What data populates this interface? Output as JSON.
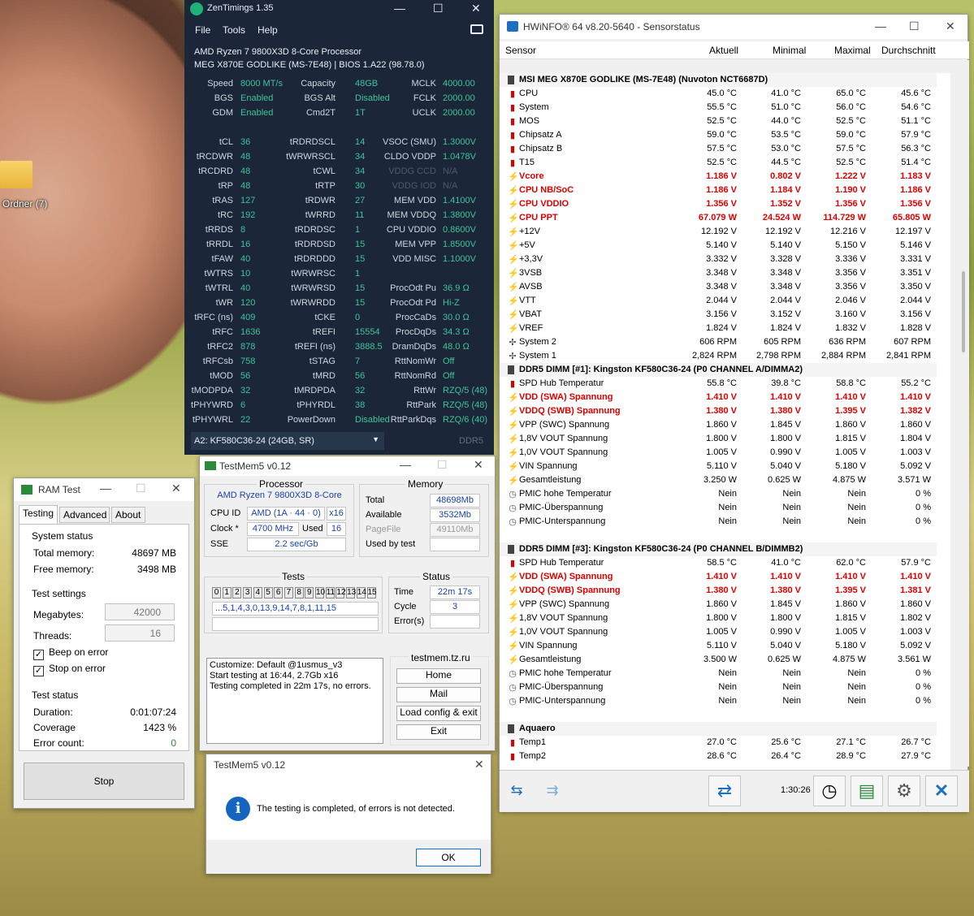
{
  "desktop": {
    "folder_label": "Ordner (7)"
  },
  "zentimings": {
    "title": "ZenTimings 1.35",
    "menu": [
      "File",
      "Tools",
      "Help"
    ],
    "cpu": "AMD Ryzen 7 9800X3D 8-Core Processor",
    "board": "MEG X870E GODLIKE (MS-7E48) | BIOS 1.A22 (98.78.0)",
    "rows": [
      [
        [
          "Speed",
          "8000 MT/s"
        ],
        [
          "Capacity",
          "48GB"
        ],
        [
          "MCLK",
          "4000.00"
        ]
      ],
      [
        [
          "BGS",
          "Enabled"
        ],
        [
          "BGS Alt",
          "Disabled"
        ],
        [
          "FCLK",
          "2000.00"
        ]
      ],
      [
        [
          "GDM",
          "Enabled"
        ],
        [
          "Cmd2T",
          "1T"
        ],
        [
          "UCLK",
          "2000.00"
        ]
      ],
      [
        [
          "",
          ""
        ],
        [
          "",
          ""
        ],
        [
          "",
          ""
        ]
      ],
      [
        [
          "tCL",
          "36"
        ],
        [
          "tRDRDSCL",
          "14"
        ],
        [
          "VSOC (SMU)",
          "1.3000V"
        ]
      ],
      [
        [
          "tRCDWR",
          "48"
        ],
        [
          "tWRWRSCL",
          "34"
        ],
        [
          "CLDO VDDP",
          "1.0478V"
        ]
      ],
      [
        [
          "tRCDRD",
          "48"
        ],
        [
          "tCWL",
          "34"
        ],
        [
          "VDDG CCD",
          "N/A"
        ]
      ],
      [
        [
          "tRP",
          "48"
        ],
        [
          "tRTP",
          "30"
        ],
        [
          "VDDG IOD",
          "N/A"
        ]
      ],
      [
        [
          "tRAS",
          "127"
        ],
        [
          "tRDWR",
          "27"
        ],
        [
          "MEM VDD",
          "1.4100V"
        ]
      ],
      [
        [
          "tRC",
          "192"
        ],
        [
          "tWRRD",
          "11"
        ],
        [
          "MEM VDDQ",
          "1.3800V"
        ]
      ],
      [
        [
          "tRRDS",
          "8"
        ],
        [
          "tRDRDSC",
          "1"
        ],
        [
          "CPU VDDIO",
          "0.8600V"
        ]
      ],
      [
        [
          "tRRDL",
          "16"
        ],
        [
          "tRDRDSD",
          "15"
        ],
        [
          "MEM VPP",
          "1.8500V"
        ]
      ],
      [
        [
          "tFAW",
          "40"
        ],
        [
          "tRDRDDD",
          "15"
        ],
        [
          "VDD MISC",
          "1.1000V"
        ]
      ],
      [
        [
          "tWTRS",
          "10"
        ],
        [
          "tWRWRSC",
          "1"
        ],
        [
          "",
          ""
        ]
      ],
      [
        [
          "tWTRL",
          "40"
        ],
        [
          "tWRWRSD",
          "15"
        ],
        [
          "ProcOdt Pu",
          "36.9 Ω"
        ]
      ],
      [
        [
          "tWR",
          "120"
        ],
        [
          "tWRWRDD",
          "15"
        ],
        [
          "ProcOdt Pd",
          "Hi-Z"
        ]
      ],
      [
        [
          "tRFC (ns)",
          "409"
        ],
        [
          "tCKE",
          "0"
        ],
        [
          "ProcCaDs",
          "30.0 Ω"
        ]
      ],
      [
        [
          "tRFC",
          "1636"
        ],
        [
          "tREFI",
          "15554"
        ],
        [
          "ProcDqDs",
          "34.3 Ω"
        ]
      ],
      [
        [
          "tRFC2",
          "878"
        ],
        [
          "tREFI (ns)",
          "3888.5"
        ],
        [
          "DramDqDs",
          "48.0 Ω"
        ]
      ],
      [
        [
          "tRFCsb",
          "758"
        ],
        [
          "tSTAG",
          "7"
        ],
        [
          "RttNomWr",
          "Off"
        ]
      ],
      [
        [
          "tMOD",
          "56"
        ],
        [
          "tMRD",
          "56"
        ],
        [
          "RttNomRd",
          "Off"
        ]
      ],
      [
        [
          "tMODPDA",
          "32"
        ],
        [
          "tMRDPDA",
          "32"
        ],
        [
          "RttWr",
          "RZQ/5 (48)"
        ]
      ],
      [
        [
          "tPHYWRD",
          "6"
        ],
        [
          "tPHYRDL",
          "38"
        ],
        [
          "RttPark",
          "RZQ/5 (48)"
        ]
      ],
      [
        [
          "tPHYWRL",
          "22"
        ],
        [
          "PowerDown",
          "Disabled"
        ],
        [
          "RttParkDqs",
          "RZQ/6 (40)"
        ]
      ]
    ],
    "dimm_select": "A2: KF580C36-24 (24GB, SR)",
    "ddr": "DDR5"
  },
  "ramtest": {
    "title": "RAM Test",
    "tabs": [
      "Testing",
      "Advanced",
      "About"
    ],
    "system_status": "System status",
    "total_memory_label": "Total memory:",
    "total_memory": "48697 MB",
    "free_memory_label": "Free memory:",
    "free_memory": "3498 MB",
    "test_settings": "Test settings",
    "megabytes_label": "Megabytes:",
    "megabytes": "42000",
    "threads_label": "Threads:",
    "threads": "16",
    "beep_label": "Beep on error",
    "stop_label": "Stop on error",
    "test_status": "Test status",
    "duration_label": "Duration:",
    "duration": "0:01:07:24",
    "coverage_label": "Coverage",
    "coverage": "1423 %",
    "errors_label": "Error count:",
    "errors": "0",
    "stop_button": "Stop"
  },
  "testmem": {
    "title": "TestMem5 v0.12",
    "processor_label": "Processor",
    "processor": "AMD Ryzen 7 9800X3D 8-Core",
    "cpuid_label": "CPU ID",
    "cpuid": "AMD  (1A · 44 · 0)",
    "threads": "x16",
    "clock_label": "Clock *",
    "clock": "4700 MHz",
    "used_label": "Used",
    "used": "16",
    "sse_label": "SSE",
    "sse": "2.2 sec/Gb",
    "memory_label": "Memory",
    "total_label": "Total",
    "total": "48698Mb",
    "available_label": "Available",
    "available": "3532Mb",
    "pagefile_label": "PageFile",
    "pagefile": "49110Mb",
    "usedbytest_label": "Used by test",
    "tests_label": "Tests",
    "test_cells": [
      "0",
      "1",
      "2",
      "3",
      "4",
      "5",
      "6",
      "7",
      "8",
      "9",
      "10",
      "11",
      "12",
      "13",
      "14",
      "15"
    ],
    "sequence": "...5,1,4,3,0,13,9,14,7,8,1,11,15",
    "status_label": "Status",
    "time_label": "Time",
    "time": "22m 17s",
    "cycle_label": "Cycle",
    "cycle": "3",
    "errors_label": "Error(s)",
    "log": [
      "Customize: Default @1usmus_v3",
      "Start testing at 16:44, 2.7Gb x16",
      "Testing completed in 22m 17s, no errors."
    ],
    "site": "testmem.tz.ru",
    "buttons": [
      "Home",
      "Mail",
      "Load config & exit",
      "Exit"
    ]
  },
  "msgbox": {
    "title": "TestMem5 v0.12",
    "text": "The testing is completed, of errors is not detected.",
    "ok": "OK"
  },
  "hwinfo": {
    "title": "HWiNFO® 64 v8.20-5640 - Sensorstatus",
    "columns": [
      "Sensor",
      "Aktuell",
      "Minimal",
      "Maximal",
      "Durchschnitt"
    ],
    "rows": [
      {
        "t": "grp",
        "n": "MSI MEG X870E GODLIKE (MS-7E48) (Nuvoton NCT6687D)"
      },
      {
        "t": "temp",
        "n": "CPU",
        "v": [
          "45.0 °C",
          "41.0 °C",
          "65.0 °C",
          "45.6 °C"
        ]
      },
      {
        "t": "temp",
        "n": "System",
        "v": [
          "55.5 °C",
          "51.0 °C",
          "56.0 °C",
          "54.6 °C"
        ]
      },
      {
        "t": "temp",
        "n": "MOS",
        "v": [
          "52.5 °C",
          "44.0 °C",
          "52.5 °C",
          "51.1 °C"
        ]
      },
      {
        "t": "temp",
        "n": "Chipsatz A",
        "v": [
          "59.0 °C",
          "53.5 °C",
          "59.0 °C",
          "57.9 °C"
        ]
      },
      {
        "t": "temp",
        "n": "Chipsatz B",
        "v": [
          "57.5 °C",
          "53.0 °C",
          "57.5 °C",
          "56.3 °C"
        ]
      },
      {
        "t": "temp",
        "n": "T15",
        "v": [
          "52.5 °C",
          "44.5 °C",
          "52.5 °C",
          "51.4 °C"
        ]
      },
      {
        "t": "volt",
        "r": 1,
        "n": "Vcore",
        "v": [
          "1.186 V",
          "0.802 V",
          "1.222 V",
          "1.183 V"
        ]
      },
      {
        "t": "volt",
        "r": 1,
        "n": "CPU NB/SoC",
        "v": [
          "1.186 V",
          "1.184 V",
          "1.190 V",
          "1.186 V"
        ]
      },
      {
        "t": "volt",
        "r": 1,
        "n": "CPU VDDIO",
        "v": [
          "1.356 V",
          "1.352 V",
          "1.356 V",
          "1.356 V"
        ]
      },
      {
        "t": "volt",
        "r": 1,
        "n": "CPU PPT",
        "v": [
          "67.079 W",
          "24.524 W",
          "114.729 W",
          "65.805 W"
        ]
      },
      {
        "t": "volt",
        "n": "+12V",
        "v": [
          "12.192 V",
          "12.192 V",
          "12.216 V",
          "12.197 V"
        ]
      },
      {
        "t": "volt",
        "n": "+5V",
        "v": [
          "5.140 V",
          "5.140 V",
          "5.150 V",
          "5.146 V"
        ]
      },
      {
        "t": "volt",
        "n": "+3,3V",
        "v": [
          "3.332 V",
          "3.328 V",
          "3.336 V",
          "3.331 V"
        ]
      },
      {
        "t": "volt",
        "n": "3VSB",
        "v": [
          "3.348 V",
          "3.348 V",
          "3.356 V",
          "3.351 V"
        ]
      },
      {
        "t": "volt",
        "n": "AVSB",
        "v": [
          "3.348 V",
          "3.348 V",
          "3.356 V",
          "3.350 V"
        ]
      },
      {
        "t": "volt",
        "n": "VTT",
        "v": [
          "2.044 V",
          "2.044 V",
          "2.046 V",
          "2.044 V"
        ]
      },
      {
        "t": "volt",
        "n": "VBAT",
        "v": [
          "3.156 V",
          "3.152 V",
          "3.160 V",
          "3.156 V"
        ]
      },
      {
        "t": "volt",
        "n": "VREF",
        "v": [
          "1.824 V",
          "1.824 V",
          "1.832 V",
          "1.828 V"
        ]
      },
      {
        "t": "fan",
        "n": "System 2",
        "v": [
          "606 RPM",
          "605 RPM",
          "636 RPM",
          "607 RPM"
        ]
      },
      {
        "t": "fan",
        "n": "System 1",
        "v": [
          "2,824 RPM",
          "2,798 RPM",
          "2,884 RPM",
          "2,841 RPM"
        ]
      },
      {
        "t": "grp",
        "n": "DDR5 DIMM [#1]: Kingston KF580C36-24 (P0 CHANNEL A/DIMMA2)"
      },
      {
        "t": "temp",
        "n": "SPD Hub Temperatur",
        "v": [
          "55.8 °C",
          "39.8 °C",
          "58.8 °C",
          "55.2 °C"
        ]
      },
      {
        "t": "volt",
        "r": 1,
        "n": "VDD (SWA) Spannung",
        "v": [
          "1.410 V",
          "1.410 V",
          "1.410 V",
          "1.410 V"
        ]
      },
      {
        "t": "volt",
        "r": 1,
        "n": "VDDQ (SWB) Spannung",
        "v": [
          "1.380 V",
          "1.380 V",
          "1.395 V",
          "1.382 V"
        ]
      },
      {
        "t": "volt",
        "n": "VPP (SWC) Spannung",
        "v": [
          "1.860 V",
          "1.845 V",
          "1.860 V",
          "1.860 V"
        ]
      },
      {
        "t": "volt",
        "n": "1,8V VOUT Spannung",
        "v": [
          "1.800 V",
          "1.800 V",
          "1.815 V",
          "1.804 V"
        ]
      },
      {
        "t": "volt",
        "n": "1,0V VOUT Spannung",
        "v": [
          "1.005 V",
          "0.990 V",
          "1.005 V",
          "1.003 V"
        ]
      },
      {
        "t": "volt",
        "n": "VIN Spannung",
        "v": [
          "5.110 V",
          "5.040 V",
          "5.180 V",
          "5.092 V"
        ]
      },
      {
        "t": "volt",
        "n": "Gesamtleistung",
        "v": [
          "3.250 W",
          "0.625 W",
          "4.875 W",
          "3.571 W"
        ]
      },
      {
        "t": "clk",
        "n": "PMIC hohe Temperatur",
        "v": [
          "Nein",
          "Nein",
          "Nein",
          "0 %"
        ]
      },
      {
        "t": "clk",
        "n": "PMIC-Überspannung",
        "v": [
          "Nein",
          "Nein",
          "Nein",
          "0 %"
        ]
      },
      {
        "t": "clk",
        "n": "PMIC-Unterspannung",
        "v": [
          "Nein",
          "Nein",
          "Nein",
          "0 %"
        ]
      },
      {
        "t": "gap"
      },
      {
        "t": "grp",
        "n": "DDR5 DIMM [#3]: Kingston KF580C36-24 (P0 CHANNEL B/DIMMB2)"
      },
      {
        "t": "temp",
        "n": "SPD Hub Temperatur",
        "v": [
          "58.5 °C",
          "41.0 °C",
          "62.0 °C",
          "57.9 °C"
        ]
      },
      {
        "t": "volt",
        "r": 1,
        "n": "VDD (SWA) Spannung",
        "v": [
          "1.410 V",
          "1.410 V",
          "1.410 V",
          "1.410 V"
        ]
      },
      {
        "t": "volt",
        "r": 1,
        "n": "VDDQ (SWB) Spannung",
        "v": [
          "1.380 V",
          "1.380 V",
          "1.395 V",
          "1.381 V"
        ]
      },
      {
        "t": "volt",
        "n": "VPP (SWC) Spannung",
        "v": [
          "1.860 V",
          "1.845 V",
          "1.860 V",
          "1.860 V"
        ]
      },
      {
        "t": "volt",
        "n": "1,8V VOUT Spannung",
        "v": [
          "1.800 V",
          "1.800 V",
          "1.815 V",
          "1.802 V"
        ]
      },
      {
        "t": "volt",
        "n": "1,0V VOUT Spannung",
        "v": [
          "1.005 V",
          "0.990 V",
          "1.005 V",
          "1.003 V"
        ]
      },
      {
        "t": "volt",
        "n": "VIN Spannung",
        "v": [
          "5.110 V",
          "5.040 V",
          "5.180 V",
          "5.092 V"
        ]
      },
      {
        "t": "volt",
        "n": "Gesamtleistung",
        "v": [
          "3.500 W",
          "0.625 W",
          "4.875 W",
          "3.561 W"
        ]
      },
      {
        "t": "clk",
        "n": "PMIC hohe Temperatur",
        "v": [
          "Nein",
          "Nein",
          "Nein",
          "0 %"
        ]
      },
      {
        "t": "clk",
        "n": "PMIC-Überspannung",
        "v": [
          "Nein",
          "Nein",
          "Nein",
          "0 %"
        ]
      },
      {
        "t": "clk",
        "n": "PMIC-Unterspannung",
        "v": [
          "Nein",
          "Nein",
          "Nein",
          "0 %"
        ]
      },
      {
        "t": "gap"
      },
      {
        "t": "grp",
        "n": "Aquaero"
      },
      {
        "t": "temp",
        "n": "Temp1",
        "v": [
          "27.0 °C",
          "25.6 °C",
          "27.1 °C",
          "26.7 °C"
        ]
      },
      {
        "t": "temp",
        "n": "Temp2",
        "v": [
          "28.6 °C",
          "26.4 °C",
          "28.9 °C",
          "27.9 °C"
        ]
      }
    ],
    "timer": "1:30:26"
  }
}
